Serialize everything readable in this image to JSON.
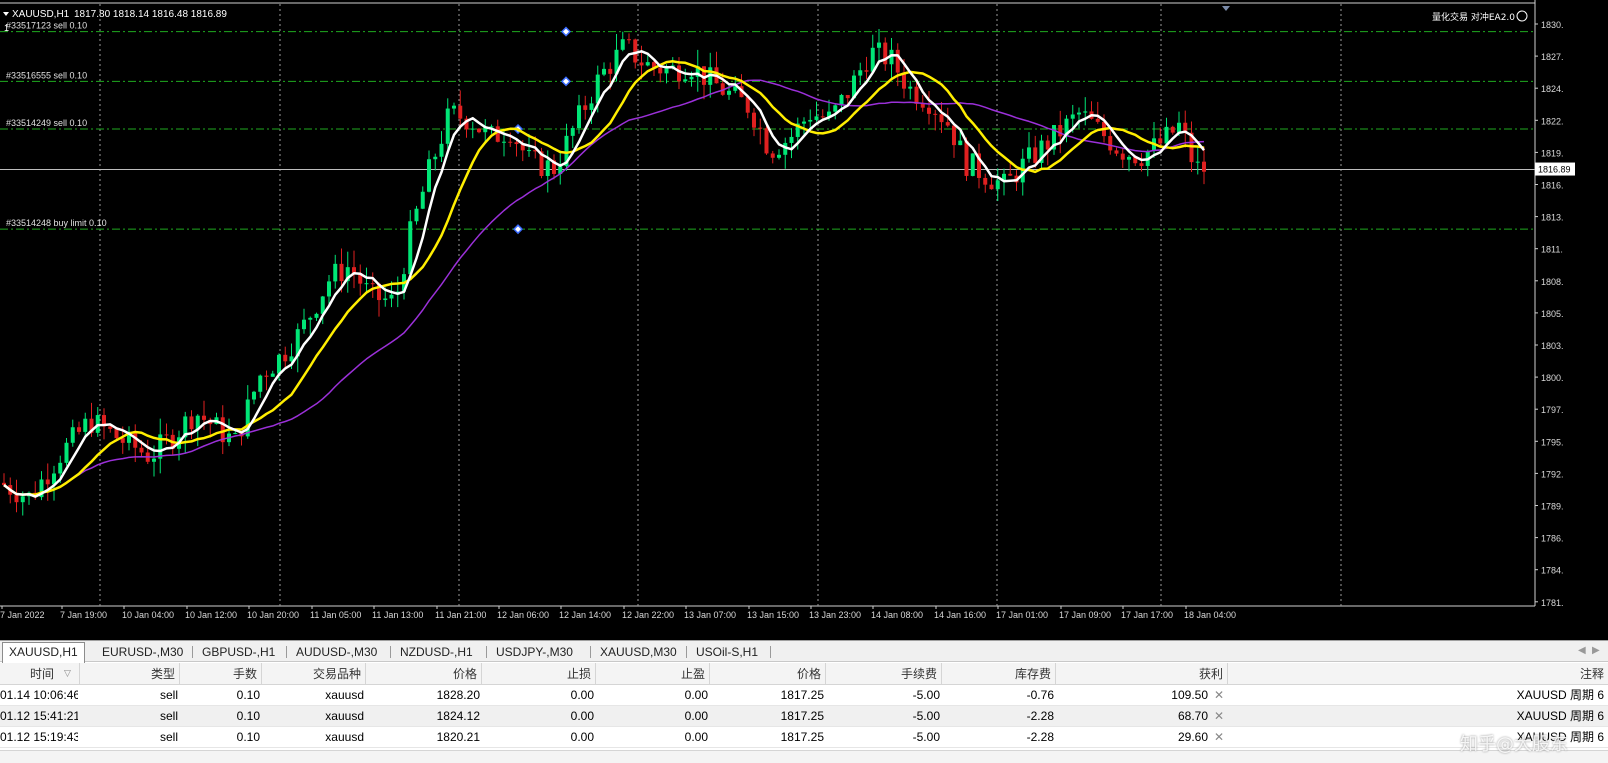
{
  "chart": {
    "header_symbol": "XAUUSD,H1",
    "header_ohlc": "1817.80 1818.14 1816.48 1816.89",
    "header_sub": "1",
    "ea_label": "量化交易 对冲EA2.0",
    "current_price_label": "1816.89",
    "order_lines": [
      {
        "label": "#33517123 sell 0.10",
        "price": 1828.2
      },
      {
        "label": "#33516555 sell 0.10",
        "price": 1824.12
      },
      {
        "label": "#33514249 sell 0.10",
        "price": 1820.21
      },
      {
        "label": "#33514248 buy limit 0.10",
        "price": 1812.0
      }
    ],
    "y_ticks": [
      "1830.",
      "1827.",
      "1824.",
      "1822.",
      "1819.",
      "1816.",
      "1813.",
      "1811.",
      "1808.",
      "1805.",
      "1803.",
      "1800.",
      "1797.",
      "1795.",
      "1792.",
      "1789.",
      "1786.",
      "1784.",
      "1781."
    ],
    "x_ticks": [
      "7 Jan 2022",
      "7 Jan 19:00",
      "10 Jan 04:00",
      "10 Jan 12:00",
      "10 Jan 20:00",
      "11 Jan 05:00",
      "11 Jan 13:00",
      "11 Jan 21:00",
      "12 Jan 06:00",
      "12 Jan 14:00",
      "12 Jan 22:00",
      "13 Jan 07:00",
      "13 Jan 15:00",
      "13 Jan 23:00",
      "14 Jan 08:00",
      "14 Jan 16:00",
      "17 Jan 01:00",
      "17 Jan 09:00",
      "17 Jan 17:00",
      "18 Jan 04:00"
    ],
    "colors": {
      "background": "#000000",
      "bull": "#00e676",
      "bear": "#e02020",
      "ma_fast": "#ffffff",
      "ma_mid": "#ffee00",
      "ma_slow": "#9b30d9",
      "order_line": "#1faa1f",
      "grid": "#9a9a9a"
    }
  },
  "tabs": [
    "XAUUSD,H1",
    "EURUSD-,M30",
    "GBPUSD-,H1",
    "AUDUSD-,M30",
    "NZDUSD-,H1",
    "USDJPY-,M30",
    "XAUUSD,M30",
    "USOil-S,H1"
  ],
  "table": {
    "headers": {
      "time": "时间",
      "type": "类型",
      "lots": "手数",
      "symbol": "交易品种",
      "price": "价格",
      "sl": "止损",
      "tp": "止盈",
      "cur_price": "价格",
      "commission": "手续费",
      "swap": "库存费",
      "profit": "获利",
      "comment": "注释"
    },
    "rows": [
      {
        "time": "01.14 10:06:46",
        "type": "sell",
        "lots": "0.10",
        "symbol": "xauusd",
        "price": "1828.20",
        "sl": "0.00",
        "tp": "0.00",
        "cur_price": "1817.25",
        "commission": "-5.00",
        "swap": "-0.76",
        "profit": "109.50",
        "comment": "XAUUSD 周期 6"
      },
      {
        "time": "01.12 15:41:21",
        "type": "sell",
        "lots": "0.10",
        "symbol": "xauusd",
        "price": "1824.12",
        "sl": "0.00",
        "tp": "0.00",
        "cur_price": "1817.25",
        "commission": "-5.00",
        "swap": "-2.28",
        "profit": "68.70",
        "comment": "XAUUSD 周期 6"
      },
      {
        "time": "01.12 15:19:43",
        "type": "sell",
        "lots": "0.10",
        "symbol": "xauusd",
        "price": "1820.21",
        "sl": "0.00",
        "tp": "0.00",
        "cur_price": "1817.25",
        "commission": "-5.00",
        "swap": "-2.28",
        "profit": "29.60",
        "comment": "XAUUSD 周期 6"
      }
    ]
  },
  "watermark": "知乎@大股东"
}
